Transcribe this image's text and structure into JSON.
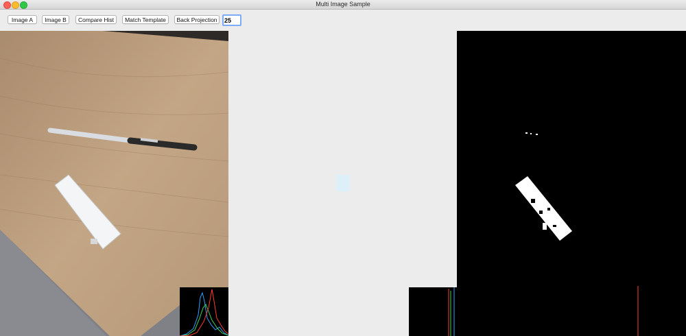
{
  "window": {
    "title": "Multi Image Sample"
  },
  "toolbar": {
    "image_a_label": "Image A",
    "image_b_label": "Image B",
    "compare_hist_label": "Compare Hist",
    "match_template_label": "Match Template",
    "back_projection_label": "Back Projection",
    "threshold_value": "25"
  },
  "colors": {
    "window_bg": "#ececec",
    "field_focus": "#7aacf7",
    "close": "#fc5f57",
    "minimize": "#fdbc2e",
    "zoom": "#33c748"
  },
  "icons": [
    "close-icon",
    "minimize-icon",
    "zoom-icon"
  ]
}
